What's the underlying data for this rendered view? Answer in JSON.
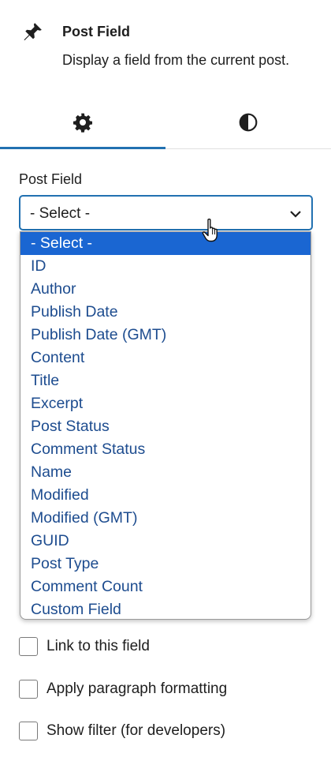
{
  "block": {
    "icon": "pin-icon",
    "title": "Post Field",
    "description": "Display a field from the current post."
  },
  "tabs": [
    {
      "icon": "gear-icon",
      "active": true
    },
    {
      "icon": "contrast-icon",
      "active": false
    }
  ],
  "post_field": {
    "label": "Post Field",
    "selected": "- Select -",
    "options": [
      "- Select -",
      "ID",
      "Author",
      "Publish Date",
      "Publish Date (GMT)",
      "Content",
      "Title",
      "Excerpt",
      "Post Status",
      "Comment Status",
      "Name",
      "Modified",
      "Modified (GMT)",
      "GUID",
      "Post Type",
      "Comment Count",
      "Custom Field"
    ]
  },
  "checkboxes": [
    {
      "label": "Link to this field",
      "checked": false
    },
    {
      "label": "Apply paragraph formatting",
      "checked": false
    },
    {
      "label": "Show filter (for developers)",
      "checked": false
    }
  ],
  "colors": {
    "accent": "#2271b1",
    "option_highlight": "#1a66d2",
    "option_text": "#1d4c8f"
  }
}
